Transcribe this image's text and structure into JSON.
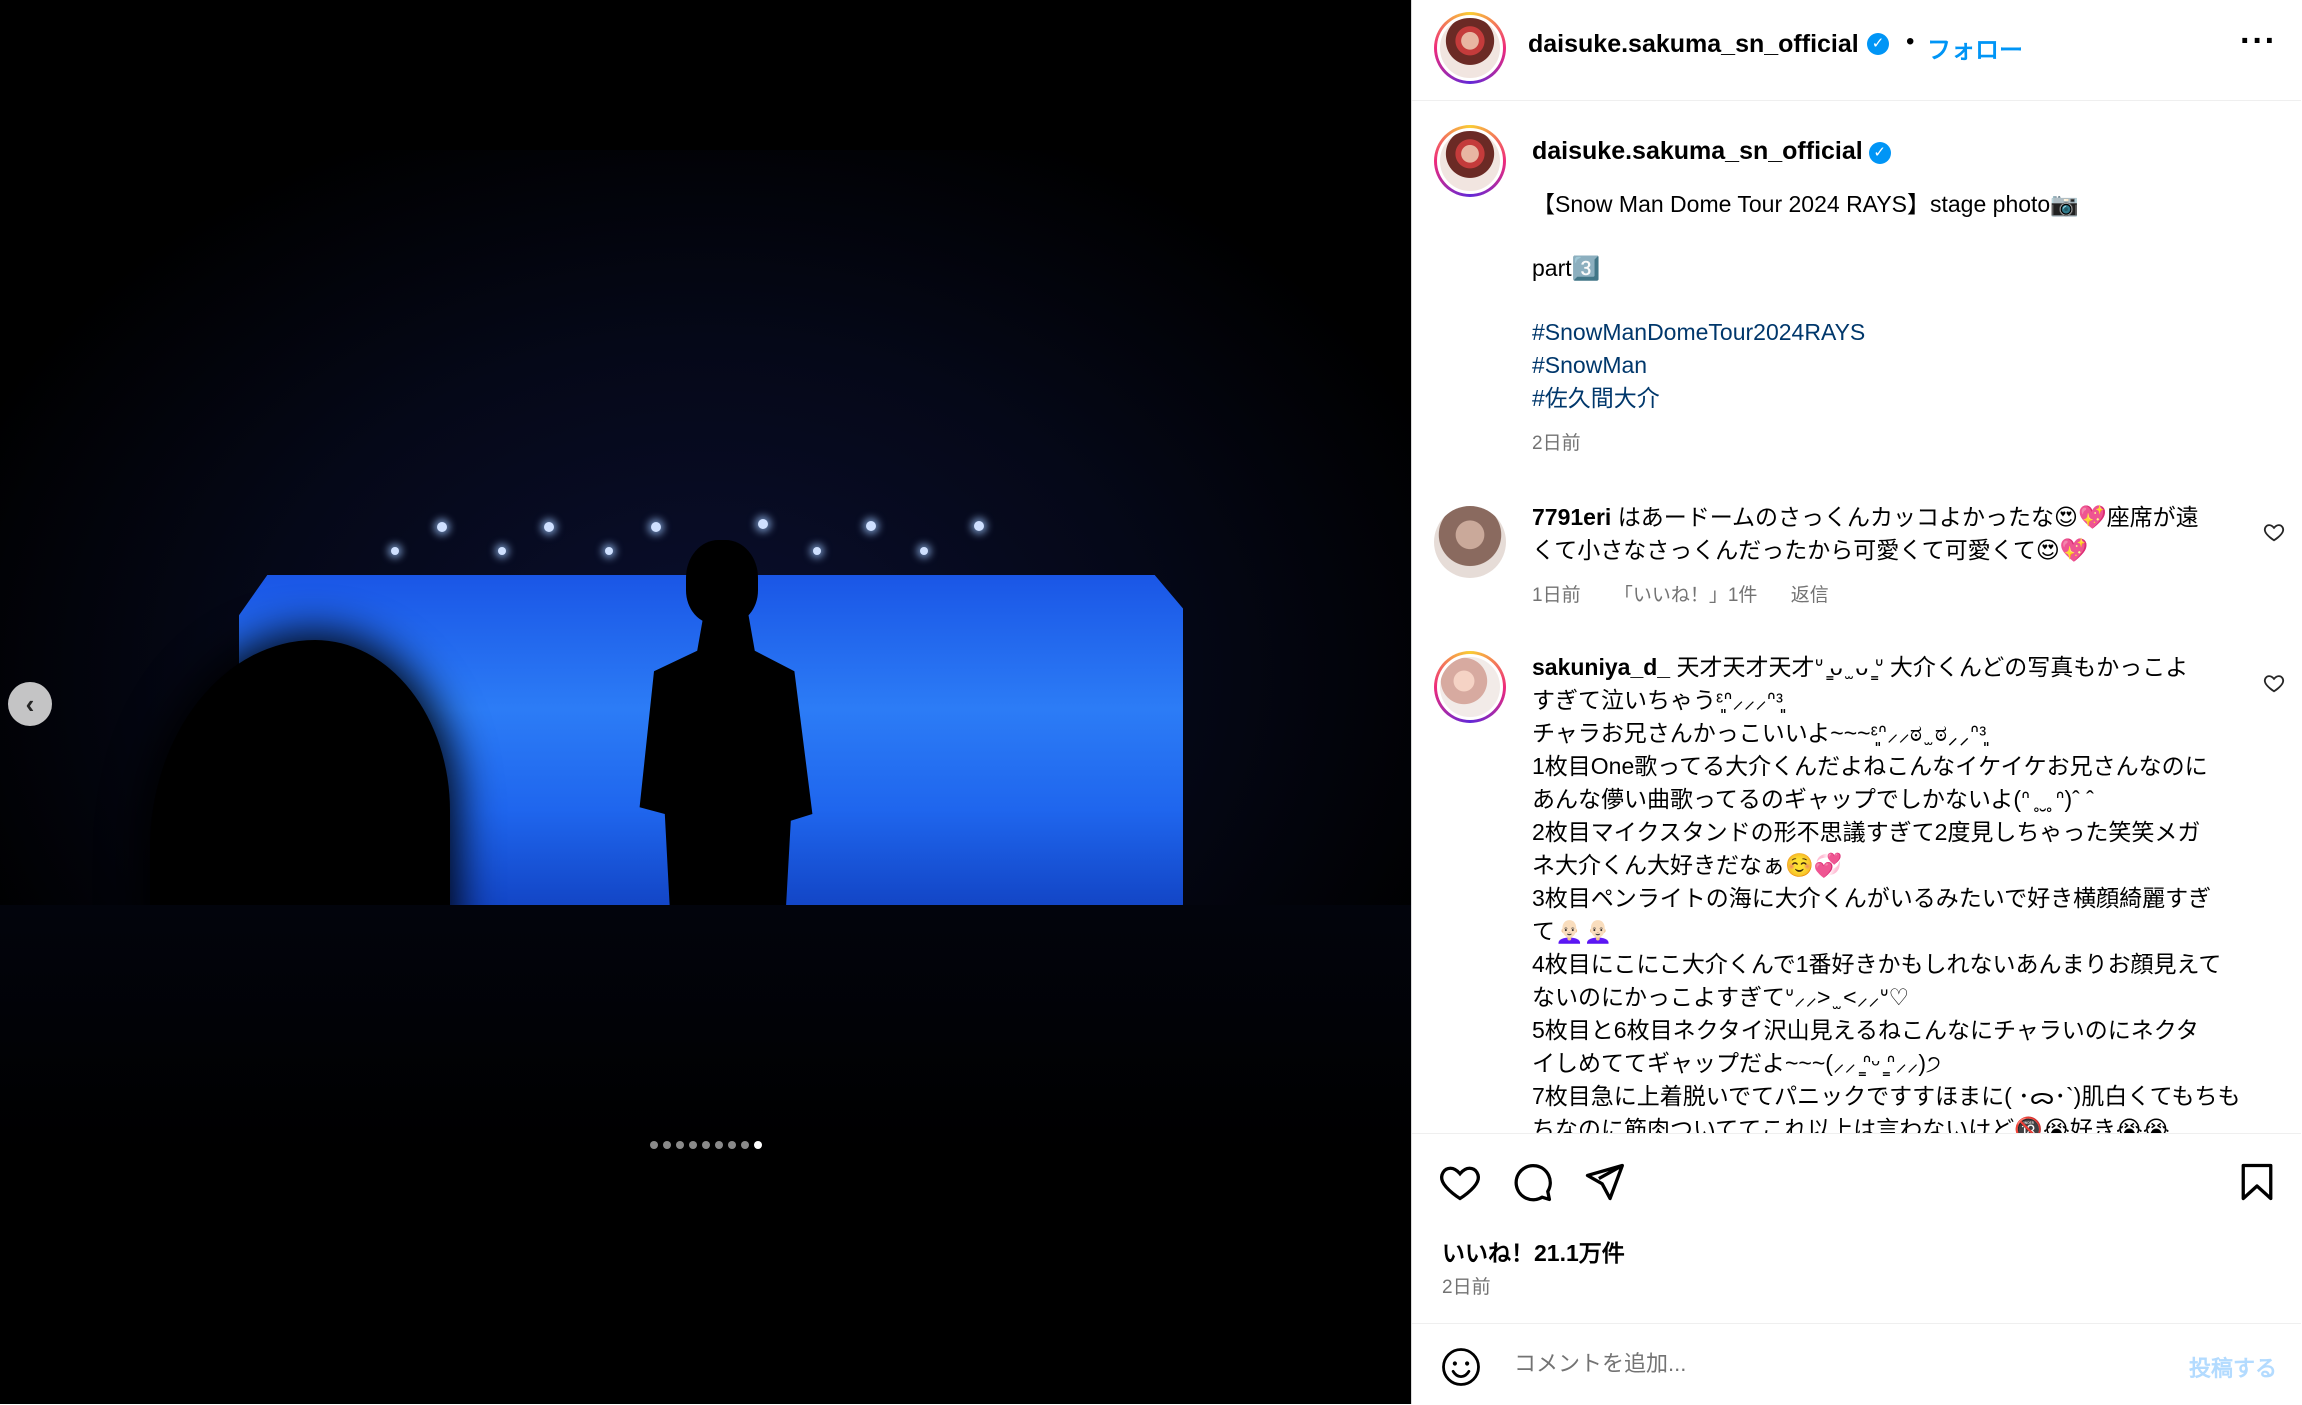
{
  "post": {
    "username": "daisuke.sakuma_sn_official",
    "verified_glyph": "✓",
    "separator": "•",
    "follow_label": "フォロー",
    "more_label": "···",
    "caption_title": "【Snow Man Dome Tour 2024 RAYS】stage photo📷",
    "caption_part": "part3️⃣",
    "hashtags": [
      "#SnowManDomeTour2024RAYS",
      "#SnowMan",
      "#佐久間大介"
    ],
    "caption_time": "2日前",
    "likes": "いいね！21.1万件",
    "date": "2日前"
  },
  "media": {
    "prev_glyph": "‹",
    "slide_count": 9,
    "active_slide": 9
  },
  "comments": [
    {
      "username": "7791eri",
      "text_lines": [
        "はあードームのさっくんカッコよかったな😍💖座席が遠",
        "くて小さなさっくんだったから可愛くて可愛くて😍💖"
      ],
      "time": "1日前",
      "likes": "「いいね！」1件",
      "reply": "返信"
    },
    {
      "username": "sakuniya_d_",
      "text_lines": [
        "天才天才天才ᐡ ̳ᴗ ̫ ᴗ ̳ᐡ 大介くんどの写真もかっこよ",
        "すぎて泣いちゃうᵋ͈ᐢ⸝⸝⸝ᐢᵌ͈",
        "チャラお兄さんかっこいいよ~~~ᵋ͈ᐢ⸝⸝ಠ ̫ ಠ⸝⸝ᐢᵌ͈",
        "1枚目One歌ってる大介くんだよねこんなイケイケお兄さんなのに",
        "あんな儚い曲歌ってるのギャップでしかないよ(ᐢ ̥ ̮ ̥ ᐢ)ˆ ˆ",
        "2枚目マイクスタンドの形不思議すぎて2度見しちゃった笑笑メガ",
        "ネ大介くん大好きだなぁ☺️💞",
        "3枚目ペンライトの海に大介くんがいるみたいで好き横顔綺麗すぎ",
        "て👩🏻‍🦲👩🏻‍🦲",
        "4枚目にこにこ大介くんで1番好きかもしれないあんまりお顔見えて",
        "ないのにかっこよすぎてᐡ⸝⸝> ̫ <⸝⸝ᐡ♡",
        "5枚目と6枚目ネクタイ沢山見えるねこんなにチャラいのにネクタ",
        "イしめててギャップだよ~~~(⸝⸝ ̳ᐢᵕ ̳ᐢ⸝⸝)੭",
        "7枚目急に上着脱いでてパニックですすほまに( ･ᯅ･`)肌白くてもちも",
        "ちなのに筋肉ついててこれ以上は言わないけど🔞😭好き😭😭"
      ]
    }
  ],
  "composer": {
    "placeholder": "コメントを追加...",
    "post_label": "投稿する"
  },
  "icons": {
    "like": "heart-icon",
    "comment": "comment-icon",
    "share": "send-icon",
    "save": "bookmark-icon",
    "emoji": "smiley-icon"
  },
  "colors": {
    "accent": "#0095f6",
    "hashtag": "#00376b",
    "muted": "#737373",
    "screen_blue": "#2c7cf6"
  }
}
